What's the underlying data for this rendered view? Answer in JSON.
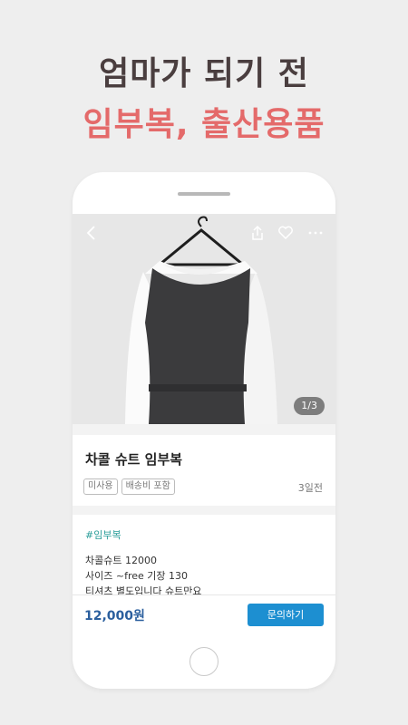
{
  "headline": {
    "line1": "엄마가 되기 전",
    "line2": "임부복, 출산용품",
    "line1_color": "#4a3e3f",
    "line2_color": "#e46a6a"
  },
  "product": {
    "image_counter": "1/3",
    "title": "차콜 슈트 임부복",
    "tags": [
      "미사용",
      "배송비 포함"
    ],
    "posted": "3일전",
    "hashtag": "#임부복",
    "description": [
      "차콜슈트 12000",
      "사이즈 ~free  기장 130",
      "티셔츠 별도입니다 슈트만요"
    ],
    "price": "12,000원",
    "inquire_label": "문의하기"
  },
  "icons": {
    "back": "chevron-left-icon",
    "share": "share-icon",
    "like": "heart-icon",
    "more": "more-horizontal-icon"
  },
  "colors": {
    "accent": "#1d8fd1",
    "price": "#2b5f9e",
    "hashtag": "#2a9d9a"
  }
}
